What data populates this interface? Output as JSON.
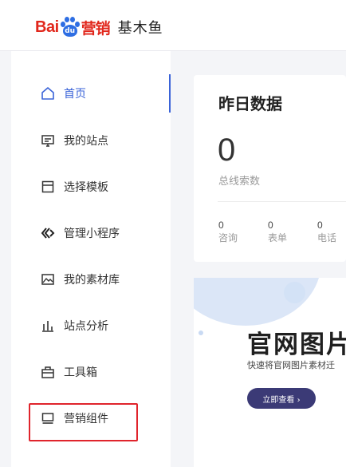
{
  "header": {
    "logo_bai": "Bai",
    "logo_du": "du",
    "logo_yingxiao": "营销",
    "product_name": "基木鱼"
  },
  "sidebar": {
    "items": [
      {
        "label": "首页",
        "icon": "home-icon",
        "active": true
      },
      {
        "label": "我的站点",
        "icon": "monitor-icon",
        "active": false
      },
      {
        "label": "选择模板",
        "icon": "template-icon",
        "active": false
      },
      {
        "label": "管理小程序",
        "icon": "miniprogram-icon",
        "active": false
      },
      {
        "label": "我的素材库",
        "icon": "image-library-icon",
        "active": false
      },
      {
        "label": "站点分析",
        "icon": "bar-chart-icon",
        "active": false
      },
      {
        "label": "工具箱",
        "icon": "toolbox-icon",
        "active": false
      },
      {
        "label": "营销组件",
        "icon": "component-icon",
        "active": false
      }
    ],
    "highlight_color": "#e0242c",
    "accent_color": "#3a63d8"
  },
  "stats_card": {
    "title": "昨日数据",
    "total_value": "0",
    "total_label": "总线索数",
    "items": [
      {
        "value": "0",
        "label": "咨询"
      },
      {
        "value": "0",
        "label": "表单"
      },
      {
        "value": "0",
        "label": "电话"
      }
    ]
  },
  "banner": {
    "title": "官网图片",
    "subtitle": "快速将官网图片素材迁",
    "button_label": "立即查看 ›"
  }
}
